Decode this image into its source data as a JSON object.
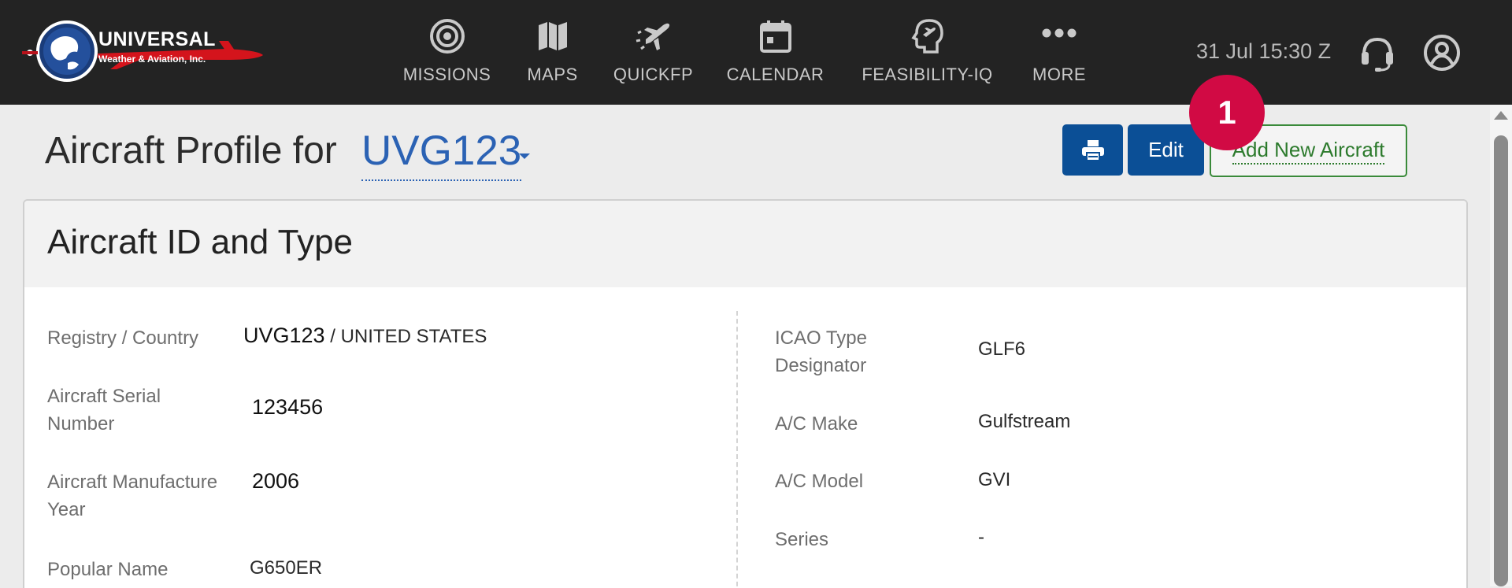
{
  "header": {
    "logo_brand": "UNIVERSAL",
    "logo_subtitle": "Weather & Aviation, Inc.",
    "logo_icon": "globe-plane-logo",
    "nav": [
      {
        "label": "MISSIONS",
        "icon": "target-icon"
      },
      {
        "label": "MAPS",
        "icon": "map-icon"
      },
      {
        "label": "QUICKFP",
        "icon": "plane-departure-icon"
      },
      {
        "label": "CALENDAR",
        "icon": "calendar-icon"
      },
      {
        "label": "FEASIBILITY-IQ",
        "icon": "head-plane-icon"
      },
      {
        "label": "MORE",
        "icon": "more-dots-icon"
      }
    ],
    "time": "31 Jul 15:30 Z",
    "support_icon": "headset-icon",
    "user_icon": "user-circle-icon",
    "background_color": "#232323"
  },
  "title_row": {
    "prefix": "Aircraft Profile for",
    "tail_number": "UVG123",
    "print_icon": "printer-icon",
    "edit_label": "Edit",
    "add_label": "Add New Aircraft",
    "primary_color": "#0b4f96",
    "add_color": "#2c7a2c"
  },
  "step_badge": {
    "number": "1",
    "color": "#d10a44"
  },
  "panel": {
    "title": "Aircraft ID and Type",
    "left": {
      "registry_label": "Registry / Country",
      "registry_value": "UVG123",
      "registry_separator": "/",
      "country_value": "UNITED STATES",
      "serial_label_line1": "Aircraft Serial",
      "serial_label_line2": "Number",
      "serial_value": "123456",
      "year_label_line1": "Aircraft Manufacture",
      "year_label_line2": "Year",
      "year_value": "2006",
      "popular_label": "Popular Name",
      "popular_value": "G650ER"
    },
    "right": {
      "icao_label_line1": "ICAO Type",
      "icao_label_line2": "Designator",
      "icao_value": "GLF6",
      "make_label": "A/C Make",
      "make_value": "Gulfstream",
      "model_label": "A/C Model",
      "model_value": "GVI",
      "series_label": "Series",
      "series_value": "-"
    }
  }
}
